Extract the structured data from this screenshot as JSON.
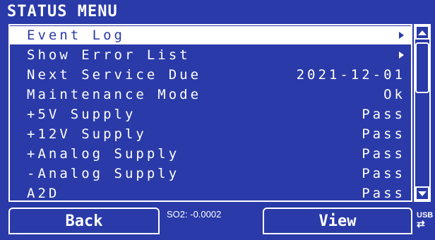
{
  "title": "STATUS MENU",
  "menu": {
    "items": [
      {
        "label": "Event Log",
        "value": "",
        "has_submenu": true,
        "selected": true
      },
      {
        "label": "Show Error List",
        "value": "",
        "has_submenu": true,
        "selected": false
      },
      {
        "label": "Next Service Due",
        "value": "2021-12-01",
        "has_submenu": false,
        "selected": false
      },
      {
        "label": "Maintenance Mode",
        "value": "Ok",
        "has_submenu": false,
        "selected": false
      },
      {
        "label": "+5V Supply",
        "value": "Pass",
        "has_submenu": false,
        "selected": false
      },
      {
        "label": "+12V Supply",
        "value": "Pass",
        "has_submenu": false,
        "selected": false
      },
      {
        "label": "+Analog Supply",
        "value": "Pass",
        "has_submenu": false,
        "selected": false
      },
      {
        "label": "-Analog Supply",
        "value": "Pass",
        "has_submenu": false,
        "selected": false
      },
      {
        "label": "A2D",
        "value": "Pass",
        "has_submenu": false,
        "selected": false
      }
    ]
  },
  "softkeys": {
    "back_label": "Back",
    "view_label": "View"
  },
  "status_readout": "SO2: -0.0002",
  "usb": {
    "label": "USB",
    "icon": "usb-transfer-icon"
  },
  "colors": {
    "background": "#2a3aa8",
    "foreground": "#ffffff"
  }
}
